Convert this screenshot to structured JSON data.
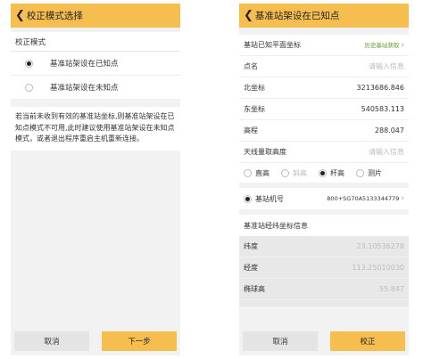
{
  "left": {
    "title": "校正模式选择",
    "section_label": "校正模式",
    "options": [
      {
        "label": "基准站架设在已知点",
        "selected": true
      },
      {
        "label": "基准站架设在未知点",
        "selected": false
      }
    ],
    "note": "若当前未收到有效的基准站坐标,则基准站架设在已知点模式不可用,此时建议使用基准站架设在未知点模式，或者退出程序重启主机重新连接。",
    "buttons": {
      "cancel": "取消",
      "next": "下一步"
    }
  },
  "right": {
    "title": "基准站架设在已知点",
    "rows": {
      "plane_coord": {
        "label": "基站已知平面坐标",
        "link": "历史基站获取"
      },
      "point_name": {
        "label": "点名",
        "placeholder": "请输入信息"
      },
      "north": {
        "label": "北坐标",
        "value": "3213686.846"
      },
      "east": {
        "label": "东坐标",
        "value": "540583.113"
      },
      "elevation": {
        "label": "高程",
        "value": "288.047"
      },
      "antenna": {
        "label": "天线量取高度",
        "placeholder": "请输入信息"
      }
    },
    "height_options": [
      {
        "label": "直高",
        "selected": false,
        "enabled": true
      },
      {
        "label": "斜高",
        "selected": false,
        "enabled": false
      },
      {
        "label": "杆高",
        "selected": true,
        "enabled": true
      },
      {
        "label": "测片",
        "selected": false,
        "enabled": true
      }
    ],
    "station": {
      "label": "基站机号",
      "value": "800+SG70A5133344779"
    },
    "info_header": "基准站经纬坐标信息",
    "coords": [
      {
        "label": "纬度",
        "value": "23.10536278"
      },
      {
        "label": "经度",
        "value": "113.25010030"
      },
      {
        "label": "椭球高",
        "value": "55.847"
      }
    ],
    "buttons": {
      "cancel": "取消",
      "confirm": "校正"
    }
  },
  "colors": {
    "accent": "#f6be4f",
    "link": "#5aa02c",
    "placeholder": "#bbbbbb"
  }
}
